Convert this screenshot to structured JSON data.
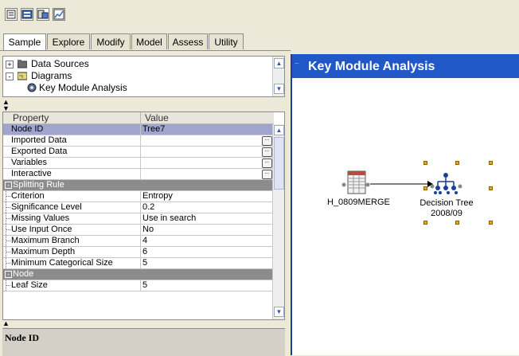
{
  "toolbar": {
    "buttons": [
      "new-project-icon",
      "open-diagram-icon",
      "run-icon",
      "results-chart-icon"
    ]
  },
  "tabs": [
    "Sample",
    "Explore",
    "Modify",
    "Model",
    "Assess",
    "Utility"
  ],
  "active_tab": "Sample",
  "project_tree": {
    "items": [
      {
        "label": "Data Sources",
        "expander": "+",
        "icon": "folder-icon"
      },
      {
        "label": "Diagrams",
        "expander": "-",
        "icon": "folder-open-icon"
      },
      {
        "label": "Key Module Analysis",
        "icon": "diagram-icon"
      }
    ]
  },
  "properties": {
    "header": {
      "property": "Property",
      "value": "Value"
    },
    "rows": [
      {
        "type": "prop",
        "name": "Node ID",
        "value": "Tree7",
        "selected": true
      },
      {
        "type": "prop",
        "name": "Imported Data",
        "value": "",
        "ellipsis": true
      },
      {
        "type": "prop",
        "name": "Exported Data",
        "value": "",
        "ellipsis": true
      },
      {
        "type": "prop",
        "name": "Variables",
        "value": "",
        "ellipsis": true
      },
      {
        "type": "prop",
        "name": "Interactive",
        "value": "",
        "ellipsis": true
      },
      {
        "type": "group",
        "name": "Splitting Rule",
        "expander": "-"
      },
      {
        "type": "prop",
        "name": "Criterion",
        "value": "Entropy"
      },
      {
        "type": "prop",
        "name": "Significance Level",
        "value": "0.2"
      },
      {
        "type": "prop",
        "name": "Missing Values",
        "value": "Use in search"
      },
      {
        "type": "prop",
        "name": "Use Input Once",
        "value": "No"
      },
      {
        "type": "prop",
        "name": "Maximum Branch",
        "value": "4"
      },
      {
        "type": "prop",
        "name": "Maximum Depth",
        "value": "6"
      },
      {
        "type": "prop",
        "name": "Minimum Categorical Size",
        "value": "5"
      },
      {
        "type": "group",
        "name": "Node",
        "expander": "-"
      },
      {
        "type": "prop",
        "name": "Leaf Size",
        "value": "5"
      }
    ]
  },
  "description": {
    "title": "Node ID"
  },
  "diagram": {
    "title": "Key Module Analysis",
    "nodes": [
      {
        "label": "H_0809MERGE",
        "icon": "data-table-icon"
      },
      {
        "label_line1": "Decision Tree",
        "label_line2": "2008/09",
        "icon": "decision-tree-icon",
        "selected": true
      }
    ]
  },
  "colors": {
    "diagram_title_bg": "#2158c8",
    "selected_row": "#9fa5cc",
    "group_row": "#8c8c8c",
    "selection_handle": "#e5a51c"
  }
}
